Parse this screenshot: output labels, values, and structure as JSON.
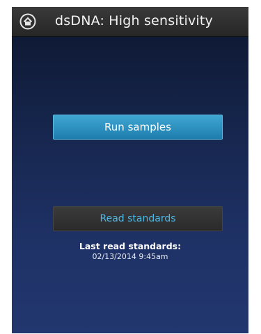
{
  "header": {
    "title": "dsDNA: High sensitivity",
    "home_icon": "home-icon"
  },
  "main": {
    "run_samples_label": "Run samples",
    "read_standards_label": "Read standards",
    "last_read_label": "Last read standards:",
    "last_read_value": "02/13/2014 9:45am"
  },
  "colors": {
    "accent": "#2a93c4",
    "screen_bg": "#1f3267",
    "header_bg": "#2f2f2f",
    "read_text": "#4fb7e4"
  }
}
